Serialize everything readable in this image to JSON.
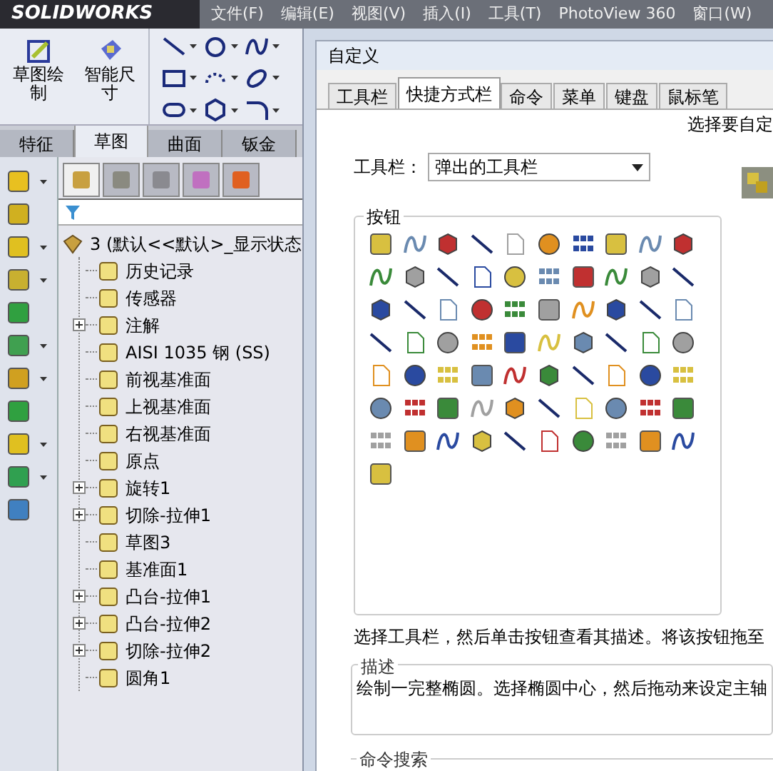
{
  "app": {
    "logo": "SOLIDWORKS",
    "menu": [
      "文件(F)",
      "编辑(E)",
      "视图(V)",
      "插入(I)",
      "工具(T)",
      "PhotoView 360",
      "窗口(W)"
    ]
  },
  "command_manager": {
    "big_buttons": [
      {
        "label": "草图绘制"
      },
      {
        "label": "智能尺寸"
      }
    ],
    "tabs": [
      {
        "label": "特征",
        "selected": false
      },
      {
        "label": "草图",
        "selected": true
      },
      {
        "label": "曲面",
        "selected": false
      },
      {
        "label": "钣金",
        "selected": false
      }
    ]
  },
  "feature_tree": {
    "panel_tabs": [
      {
        "selected": true
      },
      {
        "selected": false
      },
      {
        "selected": false
      },
      {
        "selected": false
      },
      {
        "selected": false
      }
    ],
    "root": {
      "label": "3 (默认<<默认>_显示状态",
      "children": [
        {
          "label": "历史记录",
          "expandable": false
        },
        {
          "label": "传感器",
          "expandable": false
        },
        {
          "label": "注解",
          "expandable": true
        },
        {
          "label": "AISI 1035 钢 (SS)",
          "expandable": false
        },
        {
          "label": "前视基准面",
          "expandable": false
        },
        {
          "label": "上视基准面",
          "expandable": false
        },
        {
          "label": "右视基准面",
          "expandable": false
        },
        {
          "label": "原点",
          "expandable": false
        },
        {
          "label": "旋转1",
          "expandable": true
        },
        {
          "label": "切除-拉伸1",
          "expandable": true
        },
        {
          "label": "草图3",
          "expandable": false
        },
        {
          "label": "基准面1",
          "expandable": false
        },
        {
          "label": "凸台-拉伸1",
          "expandable": true
        },
        {
          "label": "凸台-拉伸2",
          "expandable": true
        },
        {
          "label": "切除-拉伸2",
          "expandable": true
        },
        {
          "label": "圆角1",
          "expandable": false
        }
      ]
    }
  },
  "dialog": {
    "title": "自定义",
    "tabs": [
      {
        "label": "工具栏",
        "selected": false
      },
      {
        "label": "快捷方式栏",
        "selected": true
      },
      {
        "label": "命令",
        "selected": false
      },
      {
        "label": "菜单",
        "selected": false
      },
      {
        "label": "键盘",
        "selected": false
      },
      {
        "label": "鼠标笔",
        "selected": false
      }
    ],
    "hint_top": "选择要自定",
    "toolbar_label": "工具栏：",
    "toolbar_select": {
      "value": "弹出的工具栏"
    },
    "buttons_group": {
      "label": "按钮"
    },
    "instruction": "选择工具栏，然后单击按钮查看其描述。将该按钮拖至",
    "description": {
      "label": "描述",
      "text": "绘制一完整椭圆。选择椭圆中心，然后拖动来设定主轴"
    },
    "command_search": {
      "label": "命令搜索"
    }
  }
}
